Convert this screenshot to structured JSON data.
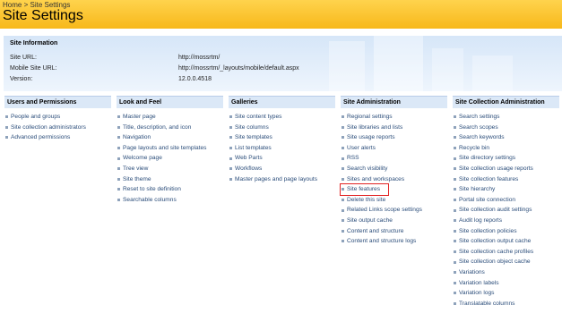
{
  "breadcrumb": [
    "Home",
    ">",
    "Site Settings"
  ],
  "page_title": "Site Settings",
  "site_info": {
    "heading": "Site Information",
    "rows": [
      {
        "label": "Site URL:",
        "value": "http://mossrtm/"
      },
      {
        "label": "Mobile Site URL:",
        "value": "http://mossrtm/_layouts/mobile/default.aspx"
      },
      {
        "label": "Version:",
        "value": "12.0.0.4518"
      }
    ]
  },
  "columns": [
    {
      "header": "Users and Permissions",
      "items": [
        "People and groups",
        "Site collection administrators",
        "Advanced permissions"
      ]
    },
    {
      "header": "Look and Feel",
      "items": [
        "Master page",
        "Title, description, and icon",
        "Navigation",
        "Page layouts and site templates",
        "Welcome page",
        "Tree view",
        "Site theme",
        "Reset to site definition",
        "Searchable columns"
      ]
    },
    {
      "header": "Galleries",
      "items": [
        "Site content types",
        "Site columns",
        "Site templates",
        "List templates",
        "Web Parts",
        "Workflows",
        "Master pages and page layouts"
      ]
    },
    {
      "header": "Site Administration",
      "items": [
        "Regional settings",
        "Site libraries and lists",
        "Site usage reports",
        "User alerts",
        "RSS",
        "Search visibility",
        "Sites and workspaces",
        "Site features",
        "Delete this site",
        "Related Links scope settings",
        "Site output cache",
        "Content and structure",
        "Content and structure logs"
      ]
    },
    {
      "header": "Site Collection Administration",
      "items": [
        "Search settings",
        "Search scopes",
        "Search keywords",
        "Recycle bin",
        "Site directory settings",
        "Site collection usage reports",
        "Site collection features",
        "Site hierarchy",
        "Portal site connection",
        "Site collection audit settings",
        "Audit log reports",
        "Site collection policies",
        "Site collection output cache",
        "Site collection cache profiles",
        "Site collection object cache",
        "Variations",
        "Variation labels",
        "Variation logs",
        "Translatable columns"
      ]
    }
  ],
  "highlighted_item": "Site features",
  "colors": {
    "title_bar": "#f7b81a",
    "link": "#2b4d7a",
    "highlight": "#e22222",
    "header_bg": "#dbe8f7"
  }
}
